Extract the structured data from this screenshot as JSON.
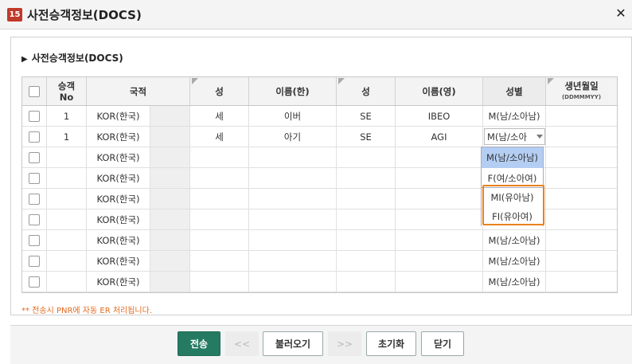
{
  "window": {
    "badge": "15",
    "title": "사전승객정보(DOCS)",
    "close_label": "✕"
  },
  "section": {
    "title": "사전승객정보(DOCS)"
  },
  "columns": {
    "pax_no": "승객",
    "pax_no_2": "No",
    "nationality": "국적",
    "surname_kr": "성",
    "given_kr": "이름(한)",
    "surname_en": "성",
    "given_en": "이름(영)",
    "gender": "성별",
    "birth": "생년월일",
    "birth_fmt": "(DDMMMYY)"
  },
  "rows": [
    {
      "no": "1",
      "nationality": "KOR(한국)",
      "surname_kr": "세",
      "given_kr": "이버",
      "surname_en": "SE",
      "given_en": "IBEO",
      "gender": "M(남/소아남)"
    },
    {
      "no": "1",
      "nationality": "KOR(한국)",
      "surname_kr": "세",
      "given_kr": "아기",
      "surname_en": "SE",
      "given_en": "AGI",
      "gender": "M(남/소아"
    },
    {
      "no": "",
      "nationality": "KOR(한국)",
      "surname_kr": "",
      "given_kr": "",
      "surname_en": "",
      "given_en": "",
      "gender": ""
    },
    {
      "no": "",
      "nationality": "KOR(한국)",
      "surname_kr": "",
      "given_kr": "",
      "surname_en": "",
      "given_en": "",
      "gender": ""
    },
    {
      "no": "",
      "nationality": "KOR(한국)",
      "surname_kr": "",
      "given_kr": "",
      "surname_en": "",
      "given_en": "",
      "gender": ""
    },
    {
      "no": "",
      "nationality": "KOR(한국)",
      "surname_kr": "",
      "given_kr": "",
      "surname_en": "",
      "given_en": "",
      "gender": ""
    },
    {
      "no": "",
      "nationality": "KOR(한국)",
      "surname_kr": "",
      "given_kr": "",
      "surname_en": "",
      "given_en": "",
      "gender": "M(남/소아남)"
    },
    {
      "no": "",
      "nationality": "KOR(한국)",
      "surname_kr": "",
      "given_kr": "",
      "surname_en": "",
      "given_en": "",
      "gender": "M(남/소아남)"
    },
    {
      "no": "",
      "nationality": "KOR(한국)",
      "surname_kr": "",
      "given_kr": "",
      "surname_en": "",
      "given_en": "",
      "gender": "M(남/소아남)"
    }
  ],
  "gender_options": [
    "M(남/소아남)",
    "F(여/소아여)",
    "MI(유아남)",
    "FI(유아여)"
  ],
  "note": "** 전송시 PNR에 자동 ER 처리됩니다.",
  "buttons": {
    "send": "전송",
    "prev": "<<",
    "load": "불러오기",
    "next": ">>",
    "reset": "초기화",
    "close": "닫기"
  },
  "colors": {
    "accent": "#257a62",
    "badge": "#c0392b",
    "highlight": "#e8821e",
    "selected": "#b4cdf2",
    "note": "#e46a1c"
  }
}
